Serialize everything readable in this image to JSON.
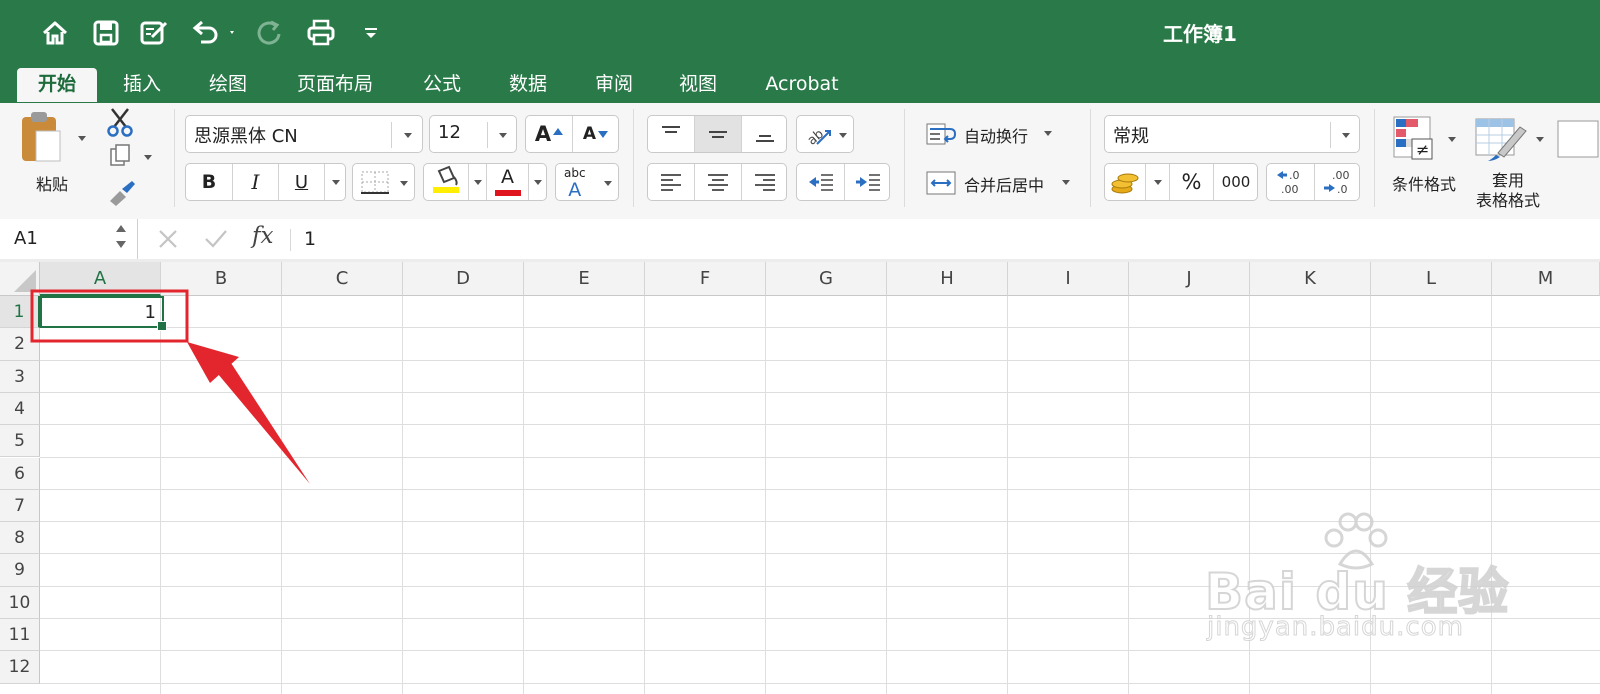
{
  "app": {
    "document_title": "工作簿1"
  },
  "quick_access": {
    "icons": [
      "home-icon",
      "save-icon",
      "edit-icon",
      "undo-icon",
      "redo-icon",
      "print-icon",
      "customize-icon"
    ]
  },
  "tabs": [
    {
      "label": "开始",
      "active": true
    },
    {
      "label": "插入"
    },
    {
      "label": "绘图"
    },
    {
      "label": "页面布局"
    },
    {
      "label": "公式"
    },
    {
      "label": "数据"
    },
    {
      "label": "审阅"
    },
    {
      "label": "视图"
    },
    {
      "label": "Acrobat"
    }
  ],
  "ribbon": {
    "paste_label": "粘贴",
    "font_name": "思源黑体 CN",
    "font_size": "12",
    "grow_font": "A",
    "shrink_font": "A",
    "bold": "B",
    "italic": "I",
    "underline": "U",
    "font_color_letter": "A",
    "phonetic_top": "abc",
    "phonetic_bottom": "A",
    "wrap_text": "自动换行",
    "merge_center": "合并后居中",
    "number_format": "常规",
    "percent": "%",
    "comma": "000",
    "conditional_format": "条件格式",
    "table_format_line1": "套用",
    "table_format_line2": "表格格式",
    "colors": {
      "highlight": "#ffee00",
      "font_color": "#e0141c"
    }
  },
  "formula_bar": {
    "name_box": "A1",
    "fx": "fx",
    "content": "1"
  },
  "grid": {
    "columns": [
      "A",
      "B",
      "C",
      "D",
      "E",
      "F",
      "G",
      "H",
      "I",
      "J",
      "K",
      "L",
      "M"
    ],
    "rows": [
      "1",
      "2",
      "3",
      "4",
      "5",
      "6",
      "7",
      "8",
      "9",
      "10",
      "11",
      "12"
    ],
    "cells": {
      "A1": "1"
    },
    "selected_cell": "A1"
  },
  "annotation": {
    "color": "#e3262e"
  },
  "watermark": {
    "brand": "Bai du 经验",
    "url": "jingyan.baidu.com"
  }
}
